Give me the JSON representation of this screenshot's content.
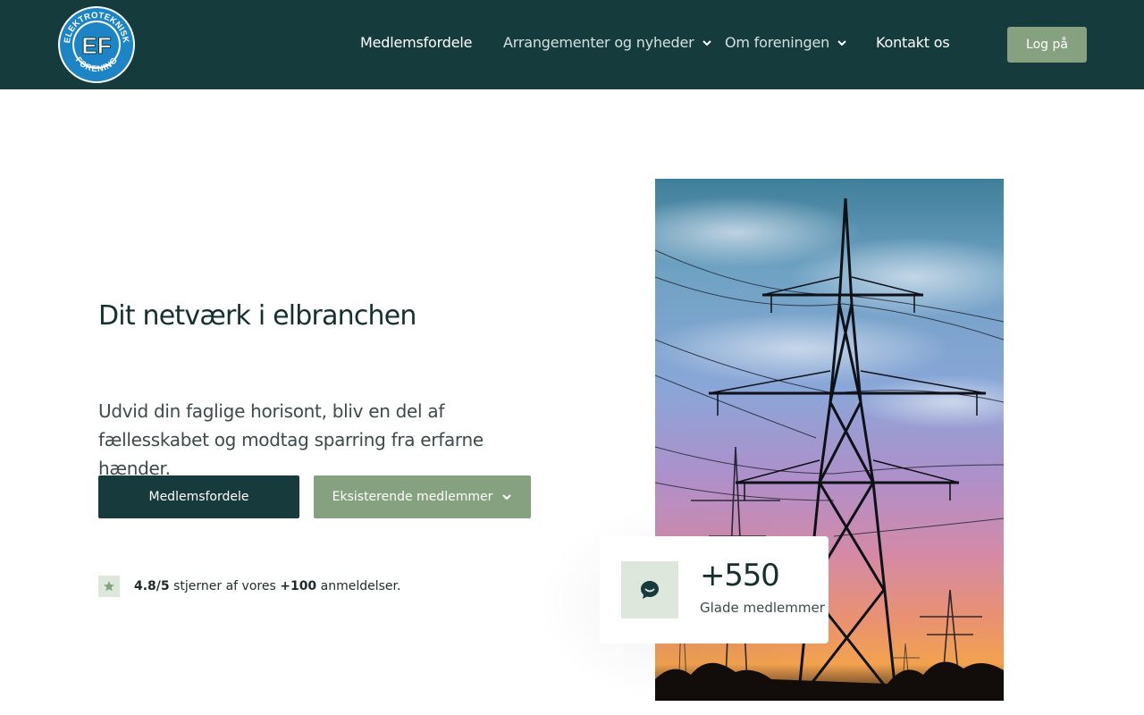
{
  "header": {
    "logo_top_text": "ELEKTROTEKNISK",
    "logo_bottom_text": "FORENING",
    "logo_initials": "EF",
    "nav": [
      {
        "label": "Medlemsfordele",
        "dropdown": false
      },
      {
        "label": "Arrangementer og nyheder",
        "dropdown": true
      },
      {
        "label": "Om foreningen",
        "dropdown": true
      },
      {
        "label": "Kontakt os",
        "dropdown": false
      }
    ],
    "login_label": "Log på"
  },
  "hero": {
    "title": "Dit netværk i elbranchen",
    "text": "Udvid din faglige horisont, bliv en del af fællesskabet og modtag sparring fra erfarne hænder.",
    "primary_button": "Medlemsfordele",
    "secondary_button": "Eksisterende medlemmer",
    "rating": {
      "score": "4.8/5",
      "middle": "stjerner af vores",
      "count": "+100",
      "suffix": "anmeldelser."
    }
  },
  "stat": {
    "value": "+550",
    "label": "Glade medlemmer"
  },
  "icons": {
    "chevron": "chevron-down-icon",
    "star": "star-icon",
    "chat": "chat-bubble-icon",
    "photo": "power-pylon-photo"
  },
  "colors": {
    "header_bg": "#153b3d",
    "accent_green": "#86a17f",
    "primary_dark": "#173b3d",
    "icon_bg": "#dde7dc"
  }
}
